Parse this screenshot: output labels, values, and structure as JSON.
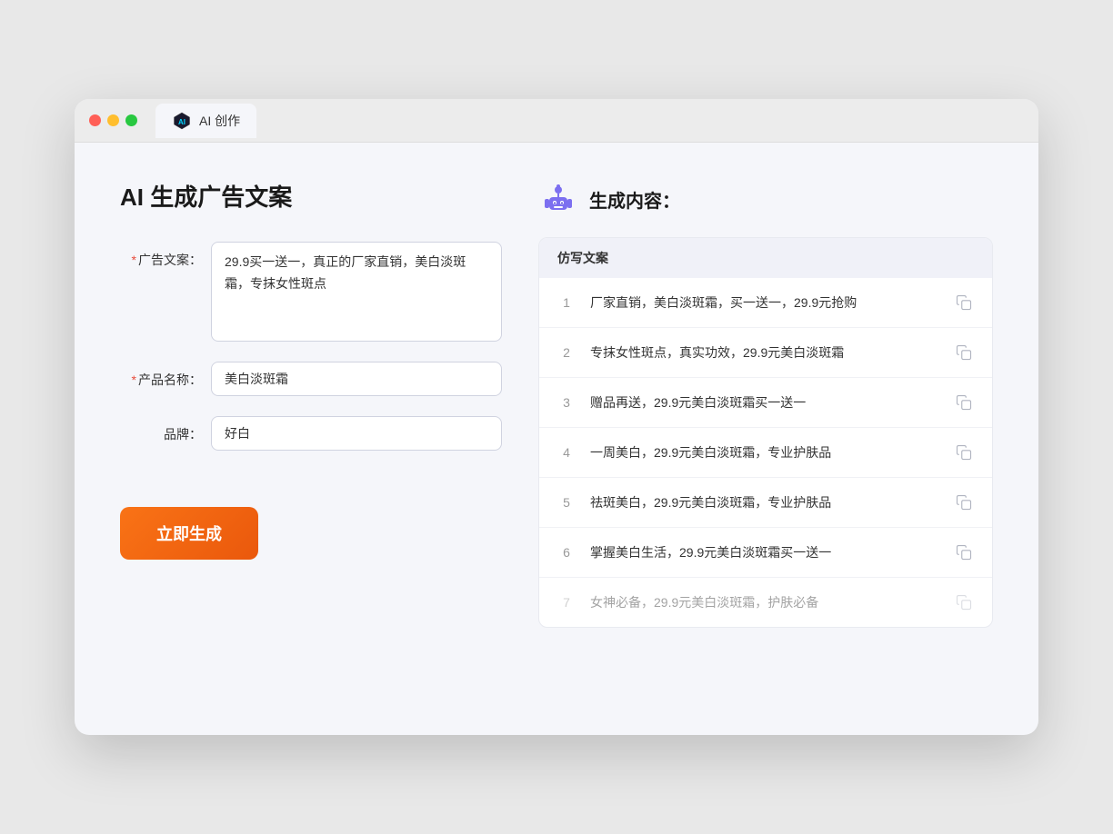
{
  "browser": {
    "tab_label": "AI 创作"
  },
  "page": {
    "title": "AI 生成广告文案",
    "result_title": "生成内容："
  },
  "form": {
    "ad_copy_label": "广告文案：",
    "ad_copy_required": true,
    "ad_copy_value": "29.9买一送一，真正的厂家直销，美白淡斑霜，专抹女性斑点",
    "product_name_label": "产品名称：",
    "product_name_required": true,
    "product_name_value": "美白淡斑霜",
    "brand_label": "品牌：",
    "brand_required": false,
    "brand_value": "好白",
    "generate_button": "立即生成"
  },
  "result": {
    "table_header": "仿写文案",
    "items": [
      {
        "num": "1",
        "text": "厂家直销，美白淡斑霜，买一送一，29.9元抢购",
        "faded": false
      },
      {
        "num": "2",
        "text": "专抹女性斑点，真实功效，29.9元美白淡斑霜",
        "faded": false
      },
      {
        "num": "3",
        "text": "赠品再送，29.9元美白淡斑霜买一送一",
        "faded": false
      },
      {
        "num": "4",
        "text": "一周美白，29.9元美白淡斑霜，专业护肤品",
        "faded": false
      },
      {
        "num": "5",
        "text": "祛斑美白，29.9元美白淡斑霜，专业护肤品",
        "faded": false
      },
      {
        "num": "6",
        "text": "掌握美白生活，29.9元美白淡斑霜买一送一",
        "faded": false
      },
      {
        "num": "7",
        "text": "女神必备，29.9元美白淡斑霜，护肤必备",
        "faded": true
      }
    ]
  },
  "colors": {
    "accent_orange": "#f97316",
    "required_red": "#e74c3c",
    "robot_purple": "#7c6ff0"
  }
}
